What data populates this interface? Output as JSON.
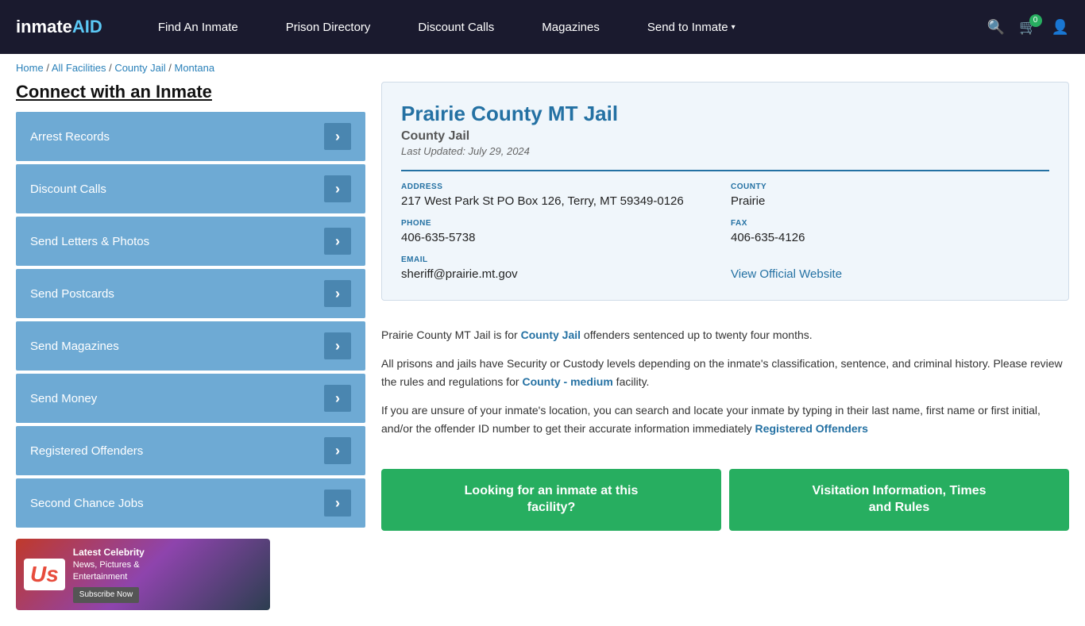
{
  "navbar": {
    "logo": "inmate",
    "logo_aid": "AID",
    "nav_items": [
      {
        "label": "Find An Inmate",
        "id": "find-inmate",
        "has_dropdown": false
      },
      {
        "label": "Prison Directory",
        "id": "prison-directory",
        "has_dropdown": false
      },
      {
        "label": "Discount Calls",
        "id": "discount-calls",
        "has_dropdown": false
      },
      {
        "label": "Magazines",
        "id": "magazines",
        "has_dropdown": false
      },
      {
        "label": "Send to Inmate",
        "id": "send-to-inmate",
        "has_dropdown": true
      }
    ],
    "cart_count": "0"
  },
  "breadcrumb": {
    "items": [
      {
        "label": "Home",
        "link": true
      },
      {
        "label": "All Facilities",
        "link": true
      },
      {
        "label": "County Jail",
        "link": true
      },
      {
        "label": "Montana",
        "link": true
      }
    ]
  },
  "sidebar": {
    "title": "Connect with an Inmate",
    "menu_items": [
      {
        "label": "Arrest Records"
      },
      {
        "label": "Discount Calls"
      },
      {
        "label": "Send Letters & Photos"
      },
      {
        "label": "Send Postcards"
      },
      {
        "label": "Send Magazines"
      },
      {
        "label": "Send Money"
      },
      {
        "label": "Registered Offenders"
      },
      {
        "label": "Second Chance Jobs"
      }
    ],
    "ad": {
      "logo_text": "Us",
      "headline": "Latest Celebrity",
      "line2": "News, Pictures &",
      "line3": "Entertainment",
      "subscribe": "Subscribe Now"
    }
  },
  "facility": {
    "name": "Prairie County MT Jail",
    "type": "County Jail",
    "last_updated": "Last Updated: July 29, 2024",
    "address_label": "ADDRESS",
    "address_value": "217 West Park St PO Box 126, Terry, MT 59349-0126",
    "county_label": "COUNTY",
    "county_value": "Prairie",
    "phone_label": "PHONE",
    "phone_value": "406-635-5738",
    "fax_label": "FAX",
    "fax_value": "406-635-4126",
    "email_label": "EMAIL",
    "email_value": "sheriff@prairie.mt.gov",
    "website_label": "View Official Website"
  },
  "description": {
    "p1_pre": "Prairie County MT Jail is for ",
    "p1_link": "County Jail",
    "p1_post": " offenders sentenced up to twenty four months.",
    "p2": "All prisons and jails have Security or Custody levels depending on the inmate's classification, sentence, and criminal history. Please review the rules and regulations for ",
    "p2_link": "County - medium",
    "p2_post": " facility.",
    "p3_pre": "If you are unsure of your inmate's location, you can search and locate your inmate by typing in their last name, first name or first initial, and/or the offender ID number to get their accurate information immediately ",
    "p3_link": "Registered Offenders"
  },
  "buttons": {
    "btn1_line1": "Looking for an inmate at this",
    "btn1_line2": "facility?",
    "btn2_line1": "Visitation Information, Times",
    "btn2_line2": "and Rules"
  }
}
